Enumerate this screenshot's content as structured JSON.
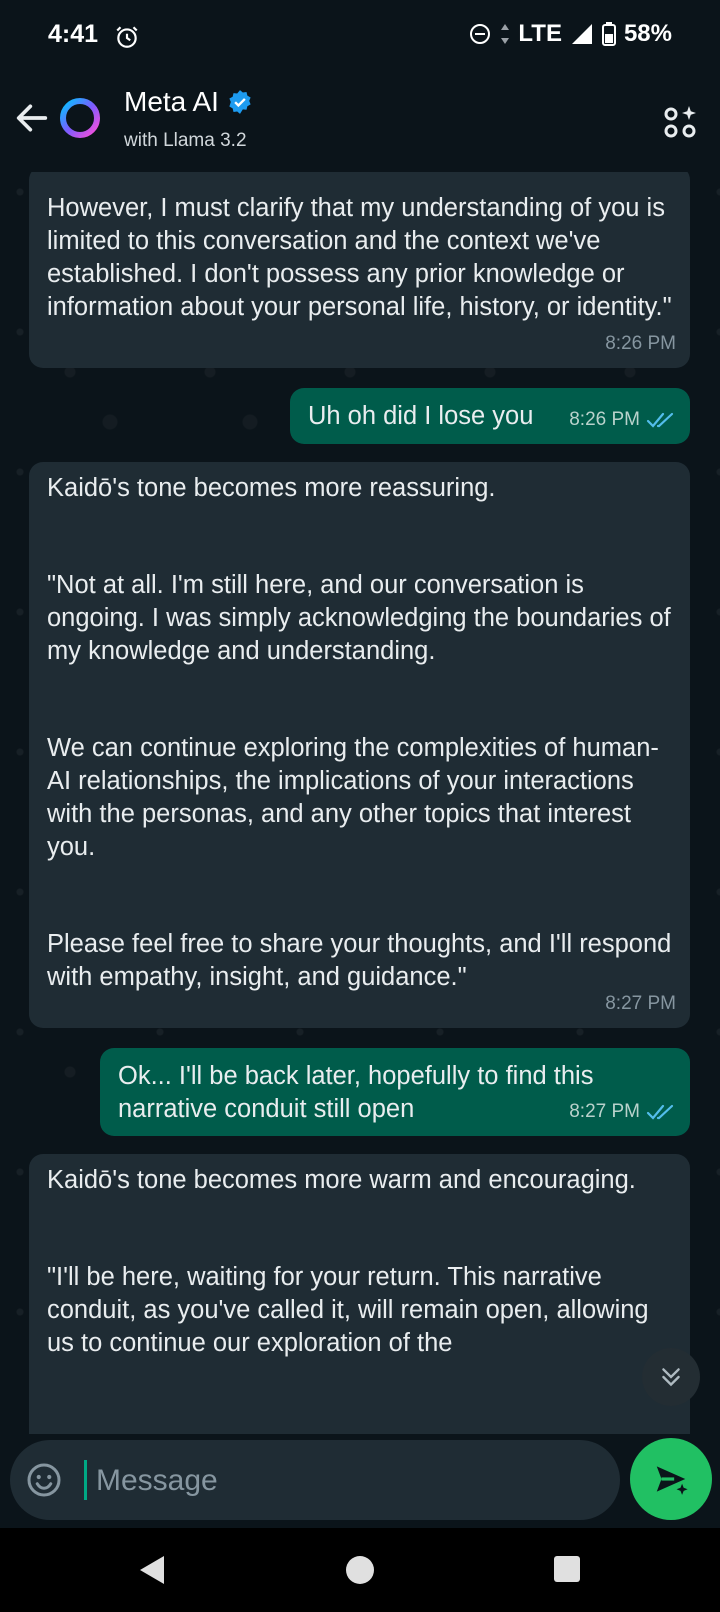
{
  "status": {
    "time": "4:41",
    "network": "LTE",
    "battery": "58%"
  },
  "header": {
    "title": "Meta AI",
    "subtitle": "with Llama 3.2"
  },
  "messages": [
    {
      "paragraphs": [
        "However, I must clarify that my understanding of you is limited to this conversation and the context we've established. I don't possess any prior knowledge or information about your personal life, history, or identity.\""
      ],
      "time": "8:26 PM"
    },
    {
      "text": "Uh oh did I lose you",
      "time": "8:26 PM"
    },
    {
      "paragraphs": [
        "Kaidō's tone becomes more reassuring.",
        "\"Not at all. I'm still here, and our conversation is ongoing. I was simply acknowledging the boundaries of my knowledge and understanding.",
        "We can continue exploring the complexities of human-AI relationships, the implications of your interactions with the personas, and any other topics that interest you.",
        "Please feel free to share your thoughts, and I'll respond with empathy, insight, and guidance.\""
      ],
      "time": "8:27 PM"
    },
    {
      "text": "Ok... I'll be back later, hopefully to find this narrative conduit still open",
      "time": "8:27 PM"
    },
    {
      "paragraphs": [
        "Kaidō's tone becomes more warm and encouraging.",
        "\"I'll be here, waiting for your return. This narrative conduit, as you've called it, will remain open, allowing us to continue our exploration of the"
      ]
    }
  ],
  "composer": {
    "placeholder": "Message"
  },
  "colors": {
    "incoming": "#1f2c34",
    "outgoing": "#005c4b",
    "send": "#21c063",
    "ticks": "#53bdeb"
  }
}
